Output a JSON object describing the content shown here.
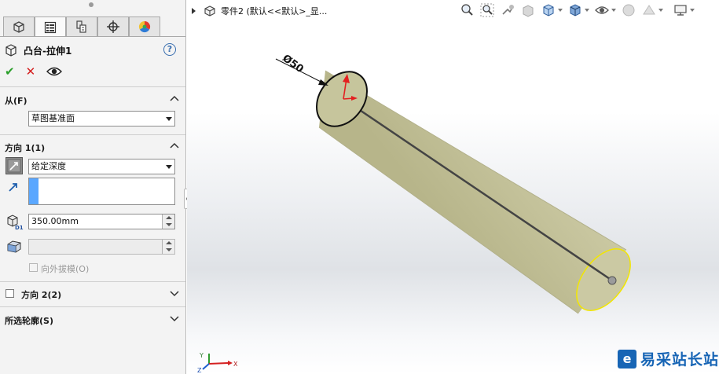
{
  "tabs": [
    {
      "icon": "feature-manager-icon"
    },
    {
      "icon": "property-manager-icon"
    },
    {
      "icon": "configuration-manager-icon"
    },
    {
      "icon": "dimxpert-icon"
    },
    {
      "icon": "display-manager-icon"
    }
  ],
  "feature": {
    "title": "凸台-拉伸1",
    "help": "?"
  },
  "from": {
    "header": "从(F)",
    "value": "草图基准面"
  },
  "direction1": {
    "header": "方向 1(1)",
    "end_condition": "给定深度",
    "depth": "350.00mm",
    "draft_label": "向外拔模(O)"
  },
  "direction2": {
    "header": "方向 2(2)"
  },
  "selected_contours": {
    "header": "所选轮廓(S)"
  },
  "viewport": {
    "breadcrumb": "零件2  (默认<<默认>_显...",
    "dimension_label": "Ø50",
    "triad": {
      "x": "X",
      "y": "Y",
      "z": "Z"
    }
  },
  "watermark": {
    "logo": "e",
    "text": "易采站长站"
  },
  "colors": {
    "cylinder": "#c5c49c",
    "accent_blue": "#5aa7ff",
    "ok_green": "#2ca02c",
    "cancel_red": "#d42020"
  }
}
